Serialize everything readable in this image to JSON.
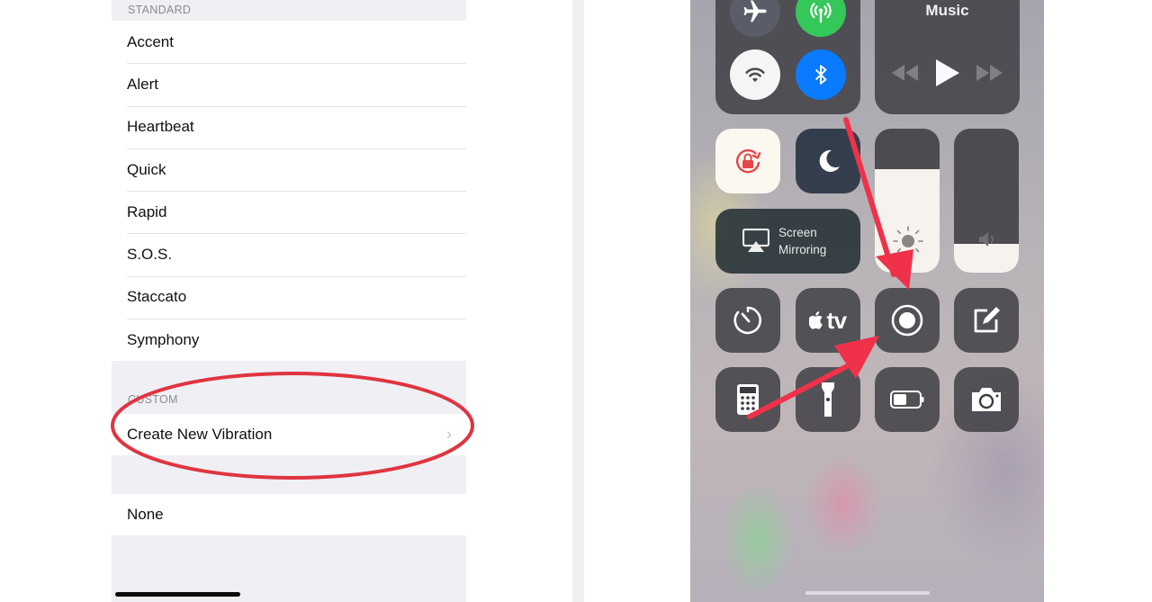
{
  "left_panel": {
    "standard_header": "STANDARD",
    "standard_items": [
      {
        "label": "Accent"
      },
      {
        "label": "Alert"
      },
      {
        "label": "Heartbeat"
      },
      {
        "label": "Quick"
      },
      {
        "label": "Rapid"
      },
      {
        "label": "S.O.S."
      },
      {
        "label": "Staccato"
      },
      {
        "label": "Symphony"
      }
    ],
    "custom_header": "CUSTOM",
    "custom_item": {
      "label": "Create New Vibration",
      "chevron": "chevron-right-icon"
    },
    "none_item": {
      "label": "None"
    },
    "annotation_color": "#e0343f"
  },
  "control_center": {
    "connectivity": {
      "airplane": {
        "icon": "airplane-icon",
        "state": "off"
      },
      "cellular": {
        "icon": "cellular-antenna-icon",
        "state": "on",
        "color": "#34c759"
      },
      "wifi": {
        "icon": "wifi-icon",
        "state": "on"
      },
      "bluetooth": {
        "icon": "bluetooth-icon",
        "state": "on",
        "color": "#0a7aff"
      }
    },
    "music": {
      "title": "Music",
      "controls": [
        "rewind-icon",
        "play-icon",
        "fast-forward-icon"
      ]
    },
    "orientation_lock": {
      "icon": "orientation-lock-icon",
      "state": "on",
      "color": "#e5474b"
    },
    "do_not_disturb": {
      "icon": "moon-icon",
      "state": "off"
    },
    "screen_mirroring": {
      "line1": "Screen",
      "line2": "Mirroring",
      "icon": "airplay-icon"
    },
    "brightness": {
      "icon": "sun-icon",
      "level": 0.72
    },
    "volume": {
      "icon": "speaker-icon",
      "level": 0.2
    },
    "row3": [
      {
        "name": "timer",
        "icon": "timer-icon"
      },
      {
        "name": "apple-tv",
        "icon": "apple-tv-icon",
        "label": "tv"
      },
      {
        "name": "screen-recording",
        "icon": "screen-record-icon"
      },
      {
        "name": "notes",
        "icon": "notes-icon"
      }
    ],
    "row4": [
      {
        "name": "calculator",
        "icon": "calculator-icon"
      },
      {
        "name": "flashlight",
        "icon": "flashlight-icon"
      },
      {
        "name": "low-power-mode",
        "icon": "battery-icon"
      },
      {
        "name": "camera",
        "icon": "camera-icon"
      }
    ],
    "arrow_color": "#f0314a"
  }
}
